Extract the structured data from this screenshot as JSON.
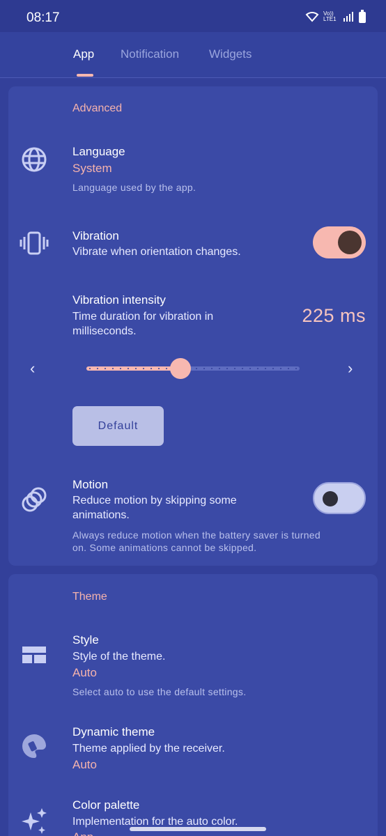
{
  "status": {
    "time": "08:17",
    "network": "Vo)) LTE1"
  },
  "tabs": [
    {
      "label": "App",
      "active": true
    },
    {
      "label": "Notification",
      "active": false
    },
    {
      "label": "Widgets",
      "active": false
    }
  ],
  "advanced": {
    "section_title": "Advanced",
    "language": {
      "title": "Language",
      "value": "System",
      "hint": "Language used by the app.",
      "icon": "globe-icon"
    },
    "vibration": {
      "title": "Vibration",
      "subtitle": "Vibrate when orientation changes.",
      "enabled": true,
      "icon": "vibration-icon"
    },
    "intensity": {
      "title": "Vibration intensity",
      "subtitle_line1": "Time duration for vibration in",
      "subtitle_line2": "milliseconds.",
      "value_text": "225 ms",
      "level": 0.44,
      "default_label": "Default"
    },
    "motion": {
      "title": "Motion",
      "subtitle_line1": "Reduce motion by skipping some",
      "subtitle_line2": "animations.",
      "hint_line1": "Always reduce motion when the battery saver is turned",
      "hint_line2": "on. Some animations cannot be skipped.",
      "enabled": false,
      "icon": "motion-rings-icon"
    }
  },
  "theme": {
    "section_title": "Theme",
    "style": {
      "title": "Style",
      "subtitle": "Style of the theme.",
      "value": "Auto",
      "hint": "Select auto to use the default settings.",
      "icon": "layout-icon"
    },
    "dynamic": {
      "title": "Dynamic theme",
      "subtitle": "Theme applied by the receiver.",
      "value": "Auto",
      "icon": "palette-icon"
    },
    "palette": {
      "title": "Color palette",
      "subtitle": "Implementation for the auto color.",
      "value": "App",
      "icon": "sparkle-icon"
    }
  },
  "colors": {
    "background": "#33409a",
    "accent": "#f7b8b0",
    "card": "#3b4aa6"
  }
}
